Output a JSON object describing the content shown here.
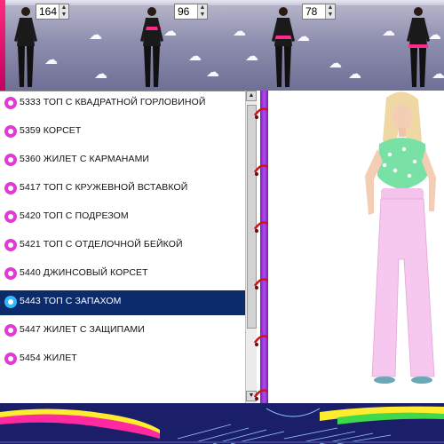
{
  "header": {
    "spinners": [
      {
        "value": "164"
      },
      {
        "value": "96"
      },
      {
        "value": "78"
      }
    ]
  },
  "list": {
    "items": [
      {
        "label": "5333 ТОП С КВАДРАТНОЙ ГОРЛОВИНОЙ",
        "selected": false
      },
      {
        "label": "5359 КОРСЕТ",
        "selected": false
      },
      {
        "label": "5360 ЖИЛЕТ С КАРМАНАМИ",
        "selected": false
      },
      {
        "label": "5417 ТОП С КРУЖЕВНОЙ ВСТАВКОЙ",
        "selected": false
      },
      {
        "label": "5420 ТОП С ПОДРЕЗОМ",
        "selected": false
      },
      {
        "label": "5421 ТОП С ОТДЕЛОЧНОЙ БЕЙКОЙ",
        "selected": false
      },
      {
        "label": "5440 ДЖИНСОВЫЙ КОРСЕТ",
        "selected": false
      },
      {
        "label": "5443 ТОП С ЗАПАХОМ",
        "selected": true
      },
      {
        "label": "5447 ЖИЛЕТ С ЗАЩИПАМИ",
        "selected": false
      },
      {
        "label": "5454 ЖИЛЕТ",
        "selected": false
      }
    ]
  },
  "colors": {
    "selected_bg": "#0b2b6b",
    "spine": "#b14cf0",
    "ring": "#c9151f",
    "flower_pink": "#e23ad6",
    "flower_blue": "#35b7ff"
  }
}
